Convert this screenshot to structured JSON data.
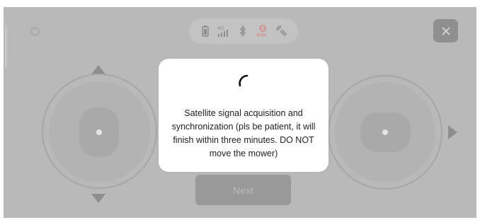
{
  "status_bar": {
    "icons": [
      "battery-icon",
      "cellular-4g-icon",
      "bluetooth-icon",
      "rtk-icon",
      "satellite-signal-icon"
    ],
    "network_label": "4G",
    "rtk_label": "RTK",
    "rtk_color": "#d88a8a"
  },
  "close_button": {
    "icon": "close-icon",
    "symbol": "×"
  },
  "next_button": {
    "label": "Next"
  },
  "dialog": {
    "message": "Satellite signal acquisition and\nsynchronization (pls be patient, it will\nfinish within three minutes. DO NOT\nmove the mower)"
  },
  "colors": {
    "overlay_background": "#b9b9b9",
    "dialog_background": "#ffffff",
    "spinner": "#111111"
  }
}
